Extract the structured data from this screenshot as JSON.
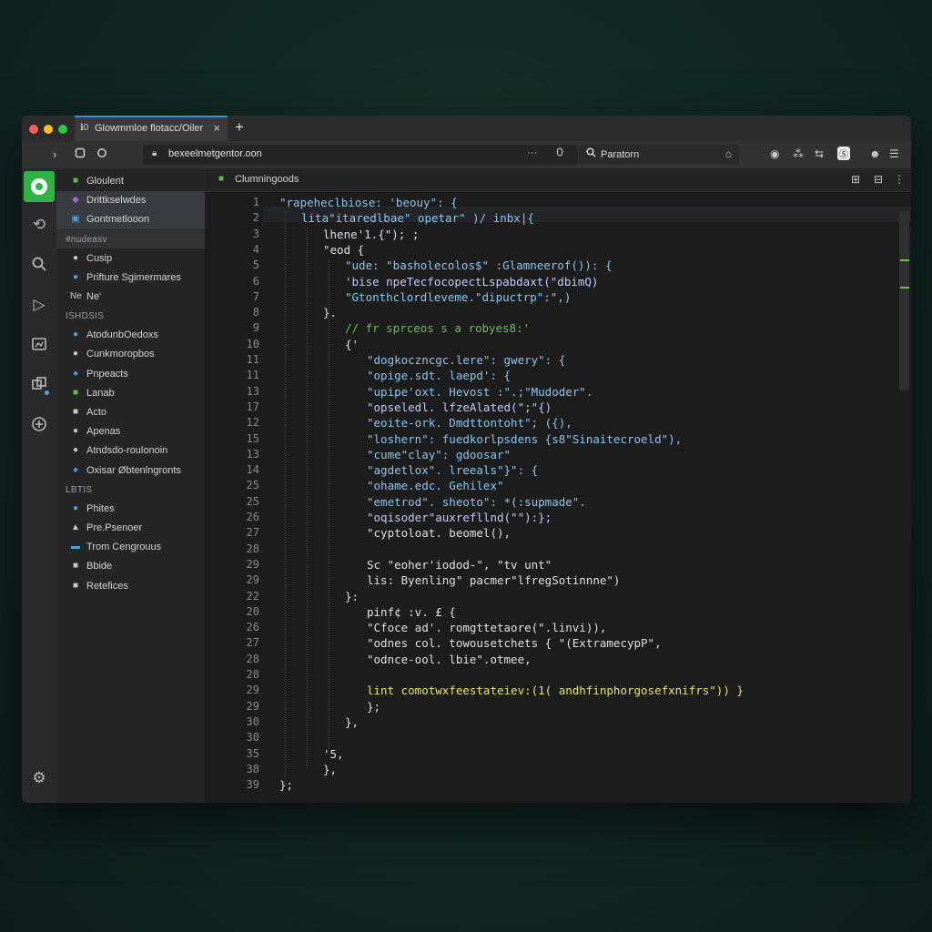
{
  "browser": {
    "tab_icon": "ℹ︎0",
    "tab_title": "Glowmmloe flotacc/Oiler",
    "tab_close": "×",
    "new_tab": "+",
    "url": "bexeelmetgentor.oon",
    "address_more": "···",
    "search_value": "Paratorn"
  },
  "sidebar": {
    "sections": [
      {
        "kind": "item",
        "icon": "■",
        "icon_color": "#5bbf4a",
        "label": "Gloulent",
        "selected": false
      },
      {
        "kind": "item",
        "icon": "◆",
        "icon_color": "#9b6bd6",
        "label": "Drittkselwdes",
        "selected": true
      },
      {
        "kind": "item",
        "icon": "▣",
        "icon_color": "#4a9fe0",
        "label": "Gontmetlooon",
        "selected": true
      },
      {
        "kind": "header",
        "label": "#nudeasv",
        "bar": true
      },
      {
        "kind": "item",
        "icon": "●",
        "icon_color": "#c9c9c9",
        "label": "Cusip"
      },
      {
        "kind": "item",
        "icon": "●",
        "icon_color": "#4a9fe0",
        "label": "Prifture Sgimermares"
      },
      {
        "kind": "item",
        "icon": "Ne",
        "icon_color": "#c9c9c9",
        "label": "Ne'"
      },
      {
        "kind": "header",
        "label": "ISHDSIS"
      },
      {
        "kind": "item",
        "icon": "●",
        "icon_color": "#4a9fe0",
        "label": "AtodunbOedoxs"
      },
      {
        "kind": "item",
        "icon": "●",
        "icon_color": "#c9c9c9",
        "label": "Cunkmoropbos"
      },
      {
        "kind": "item",
        "icon": "●",
        "icon_color": "#4a9fe0",
        "label": "Pnpeacts"
      },
      {
        "kind": "item",
        "icon": "■",
        "icon_color": "#5bbf4a",
        "label": "Lanab"
      },
      {
        "kind": "item",
        "icon": "■",
        "icon_color": "#c9c9c9",
        "label": "Acto"
      },
      {
        "kind": "item",
        "icon": "●",
        "icon_color": "#c9c9c9",
        "label": "Apenas"
      },
      {
        "kind": "item",
        "icon": "●",
        "icon_color": "#c9c9c9",
        "label": "Atndsdo‑roulonoin"
      },
      {
        "kind": "item",
        "icon": "●",
        "icon_color": "#4a9fe0",
        "label": "Oxisar Øbtenlngronts"
      },
      {
        "kind": "header",
        "label": "LBTIS"
      },
      {
        "kind": "item",
        "icon": "●",
        "icon_color": "#4a9fe0",
        "label": "Phites"
      },
      {
        "kind": "item",
        "icon": "▲",
        "icon_color": "#c9c9c9",
        "label": "Pre.Psenoer"
      },
      {
        "kind": "item",
        "icon": "▬",
        "icon_color": "#4a9fe0",
        "label": "Trom Cengrouus"
      },
      {
        "kind": "item",
        "icon": "■",
        "icon_color": "#c9c9c9",
        "label": "Bbide"
      },
      {
        "kind": "item",
        "icon": "■",
        "icon_color": "#c9c9c9",
        "label": "Retefices"
      }
    ]
  },
  "editor": {
    "tab_title": "Clumningoods",
    "lines": [
      {
        "n": "1",
        "indent": 0,
        "t": "\"rapeheclbiose: 'beouy\": {",
        "c": "#8cc6f0"
      },
      {
        "n": "2",
        "indent": 1,
        "t": "lita\"itaredlbae\" opetar\" )/ inbx|{",
        "c": "#8cc6f0"
      },
      {
        "n": "3",
        "indent": 2,
        "t": "lhene'1.{\"); ;",
        "c": "#e0e0e0"
      },
      {
        "n": "4",
        "indent": 2,
        "t": "\"eod {",
        "c": "#e0e0e0"
      },
      {
        "n": "5",
        "indent": 3,
        "t": "\"ude: \"basholecolos$\" :Glamneerof()): {",
        "c": "#8cc6f0"
      },
      {
        "n": "6",
        "indent": 3,
        "t": "'bise npeTecfocopectLspabdaxt(\"dbimQ)",
        "c": "#c8c8ff"
      },
      {
        "n": "7",
        "indent": 3,
        "t": "\"Gtonthclordleveme.\"dipuctrp\":\",)",
        "c": "#8cc6f0"
      },
      {
        "n": "8",
        "indent": 2,
        "t": "}.",
        "c": "#e0e0e0"
      },
      {
        "n": "9",
        "indent": 3,
        "t": "// fr sprceos s a robyes8:'",
        "c": "#6fbf5a"
      },
      {
        "n": "10",
        "indent": 3,
        "t": "{'",
        "c": "#e0e0e0"
      },
      {
        "n": "11",
        "indent": 4,
        "t": "\"dogkoczncgc.lere\": gwery\": {",
        "c": "#8cc6f0"
      },
      {
        "n": "11",
        "indent": 4,
        "t": "\"opige.sdt. laepd': {",
        "c": "#8cc6f0"
      },
      {
        "n": "13",
        "indent": 4,
        "t": "\"upipe'oxt. Hevost :\".;\"Mudoder\".",
        "c": "#8cc6f0"
      },
      {
        "n": "17",
        "indent": 4,
        "t": "\"opseledl. lfzeAlated(\";\"{)",
        "c": "#c8c8ff"
      },
      {
        "n": "12",
        "indent": 4,
        "t": "\"eoite-ork. Dmdttontoht\"; ({),",
        "c": "#8cc6f0"
      },
      {
        "n": "15",
        "indent": 4,
        "t": "\"loshern\": fuedkorlpsdens {s8\"Sinaitecroeld\"),",
        "c": "#8cc6f0"
      },
      {
        "n": "13",
        "indent": 4,
        "t": "\"cume\"clay\": gdoosar\"",
        "c": "#8cc6f0"
      },
      {
        "n": "14",
        "indent": 4,
        "t": "\"agdetlox\". lreeals\"}\": {",
        "c": "#8cc6f0"
      },
      {
        "n": "25",
        "indent": 4,
        "t": "\"ohame.edc. Gehilex\"",
        "c": "#8cc6f0"
      },
      {
        "n": "25",
        "indent": 4,
        "t": "\"emetrod\". sheoto\": *(:supmade\".",
        "c": "#8cc6f0"
      },
      {
        "n": "26",
        "indent": 4,
        "t": "\"oqisoder\"auxrefllnd(\"\"):};",
        "c": "#c8c8ff"
      },
      {
        "n": "27",
        "indent": 4,
        "t": "\"cyptoloat. beomel(),",
        "c": "#e0e0e0"
      },
      {
        "n": "28",
        "indent": 0,
        "t": "",
        "c": "#e0e0e0"
      },
      {
        "n": "29",
        "indent": 4,
        "t": "Sc \"eoher'iodod-\", \"tv unt\"",
        "c": "#e0e0e0"
      },
      {
        "n": "29",
        "indent": 4,
        "t": "lis: Byenling\" pacmer\"lfregSotinnne\")",
        "c": "#e0e0e0"
      },
      {
        "n": "22",
        "indent": 3,
        "t": "}:",
        "c": "#e0e0e0"
      },
      {
        "n": "20",
        "indent": 4,
        "t": "pinf¢ :v. £ {",
        "c": "#e0e0e0"
      },
      {
        "n": "26",
        "indent": 4,
        "t": "\"Cfoce ad'. romgttetaore(\".linvi)),",
        "c": "#e0e0e0"
      },
      {
        "n": "27",
        "indent": 4,
        "t": "\"odnes col. towousetchets { \"(ExtramecypP\",",
        "c": "#e0e0e0"
      },
      {
        "n": "28",
        "indent": 4,
        "t": "\"odnce-ool. lbie\".otmee,",
        "c": "#e0e0e0"
      },
      {
        "n": "28",
        "indent": 0,
        "t": "",
        "c": "#e0e0e0"
      },
      {
        "n": "29",
        "indent": 4,
        "t": "lint comotwxfeestateiev:(1( andhfinphorgosefxnifrs\")) }",
        "c": "#e8e27a"
      },
      {
        "n": "29",
        "indent": 4,
        "t": "};",
        "c": "#e0e0e0"
      },
      {
        "n": "30",
        "indent": 3,
        "t": "},",
        "c": "#e0e0e0"
      },
      {
        "n": "30",
        "indent": 0,
        "t": "",
        "c": "#e0e0e0"
      },
      {
        "n": "35",
        "indent": 2,
        "t": "'5,",
        "c": "#e0e0e0"
      },
      {
        "n": "38",
        "indent": 2,
        "t": "},",
        "c": "#e0e0e0"
      },
      {
        "n": "39",
        "indent": 0,
        "t": "};",
        "c": "#e0e0e0"
      }
    ]
  }
}
